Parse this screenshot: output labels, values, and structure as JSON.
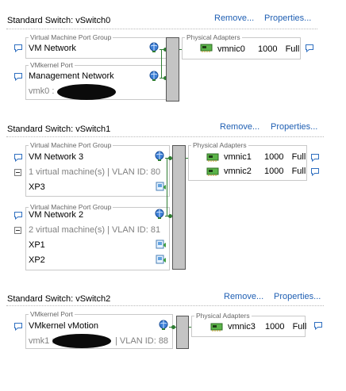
{
  "switches": [
    {
      "title": "Standard Switch: vSwitch0",
      "remove_label": "Remove...",
      "properties_label": "Properties...",
      "port_groups": [
        {
          "caption": "Virtual Machine Port Group",
          "name": "VM Network"
        },
        {
          "caption": "VMkernel Port",
          "name": "Management Network",
          "detail_prefix": "vmk0 :"
        }
      ],
      "physical_adapters_caption": "Physical Adapters",
      "adapters": [
        {
          "name": "vmnic0",
          "speed": "1000",
          "duplex": "Full"
        }
      ]
    },
    {
      "title": "Standard Switch: vSwitch1",
      "remove_label": "Remove...",
      "properties_label": "Properties...",
      "port_groups": [
        {
          "caption": "Virtual Machine Port Group",
          "name": "VM Network 3",
          "summary": "1 virtual machine(s) | VLAN ID: 80",
          "vms": [
            "XP3"
          ]
        },
        {
          "caption": "Virtual Machine Port Group",
          "name": "VM Network 2",
          "summary": "2 virtual machine(s) | VLAN ID: 81",
          "vms": [
            "XP1",
            "XP2"
          ]
        }
      ],
      "physical_adapters_caption": "Physical Adapters",
      "adapters": [
        {
          "name": "vmnic1",
          "speed": "1000",
          "duplex": "Full"
        },
        {
          "name": "vmnic2",
          "speed": "1000",
          "duplex": "Full"
        }
      ]
    },
    {
      "title": "Standard Switch: vSwitch2",
      "remove_label": "Remove...",
      "properties_label": "Properties...",
      "port_groups": [
        {
          "caption": "VMkernel Port",
          "name": "VMkernel vMotion",
          "detail_prefix": "vmk1 :",
          "detail_suffix": "| VLAN ID: 88"
        }
      ],
      "physical_adapters_caption": "Physical Adapters",
      "adapters": [
        {
          "name": "vmnic3",
          "speed": "1000",
          "duplex": "Full"
        }
      ]
    }
  ],
  "icons": {
    "info": "speech-bubble-icon",
    "port": "globe-port-icon",
    "nic": "network-card-icon",
    "vm": "virtual-machine-icon",
    "collapse": "collapse-minus-icon",
    "redaction": "redacted-scribble"
  },
  "colors": {
    "link": "#1f5fb3",
    "connection": "#2e7d32",
    "switch_bar": "#c4c4c4"
  }
}
